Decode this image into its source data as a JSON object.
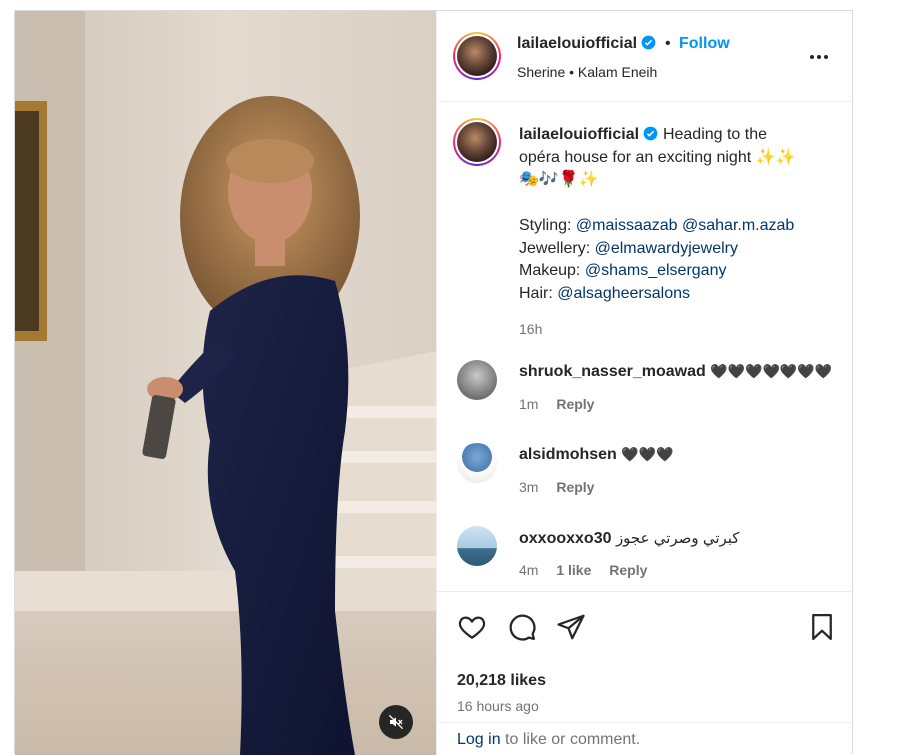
{
  "post": {
    "username": "lailaelouiofficial",
    "follow_label": "Follow",
    "audio": "Sherine • Kalam Eneih",
    "more_icon": "more-horizontal-icon"
  },
  "caption": {
    "username": "lailaelouiofficial",
    "text_line1": "Heading to the",
    "text_line2": "opéra house for an exciting night ✨✨",
    "text_line3": "🎭🎶🌹✨",
    "styling_label": "Styling:",
    "styling_mention1": "@maissaazab",
    "styling_mention2": "@sahar.m.azab",
    "jewellery_label": "Jewellery:",
    "jewellery_mention": "@elmawardyjewelry",
    "makeup_label": "Makeup:",
    "makeup_mention": "@shams_elsergany",
    "hair_label": "Hair:",
    "hair_mention": "@alsagheersalons",
    "time": "16h"
  },
  "comments": [
    {
      "username": "shruok_nasser_moawad",
      "text": "🖤🖤🖤🖤🖤🖤🖤",
      "time": "1m",
      "likes": "",
      "reply": "Reply"
    },
    {
      "username": "alsidmohsen",
      "text": "🖤🖤🖤",
      "time": "3m",
      "likes": "",
      "reply": "Reply"
    },
    {
      "username": "oxxooxxo30",
      "text": "كبرتي وصرتي عجوز",
      "time": "4m",
      "likes": "1 like",
      "reply": "Reply"
    }
  ],
  "actions": {
    "likes": "20,218 likes",
    "time_ago": "16 hours ago",
    "login_link": "Log in",
    "login_rest": " to like or comment."
  },
  "colors": {
    "accent": "#0095f6",
    "link": "#00376b",
    "text": "#262626",
    "muted": "#737373",
    "border": "#dbdbdb"
  }
}
